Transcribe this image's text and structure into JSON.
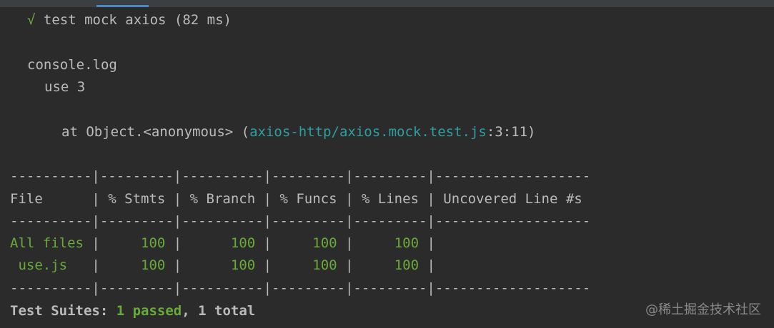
{
  "test_result": {
    "check": "√",
    "text": " test mock axios (82 ms)"
  },
  "console_log": {
    "label": "console.log",
    "message": "use 3"
  },
  "stack": {
    "prefix": "at Object.<anonymous> (",
    "file": "axios-http/axios.mock.test.js",
    "suffix": ":3:11)"
  },
  "coverage": {
    "separator": "----------|---------|----------|---------|---------|-------------------",
    "headers": [
      "File",
      "% Stmts",
      "% Branch",
      "% Funcs",
      "% Lines",
      "Uncovered Line #s"
    ],
    "header_line": "File      | % Stmts | % Branch | % Funcs | % Lines | Uncovered Line #s",
    "rows": [
      {
        "file": "All files",
        "file_cell": "All files ",
        "stmts": "100",
        "branch": "100",
        "funcs": "100",
        "lines": "100",
        "uncovered": ""
      },
      {
        "file": "use.js",
        "file_cell": " use.js   ",
        "stmts": "100",
        "branch": "100",
        "funcs": "100",
        "lines": "100",
        "uncovered": ""
      }
    ]
  },
  "summary": {
    "label": "Test Suites:",
    "passed": "1 passed",
    "rest": ", 1 total"
  },
  "watermark": "@稀土掘金技术社区",
  "colors": {
    "background": "#2b2b2b",
    "text": "#bbbbbb",
    "pass": "#6aaa3a",
    "link": "#2f9ea0"
  }
}
